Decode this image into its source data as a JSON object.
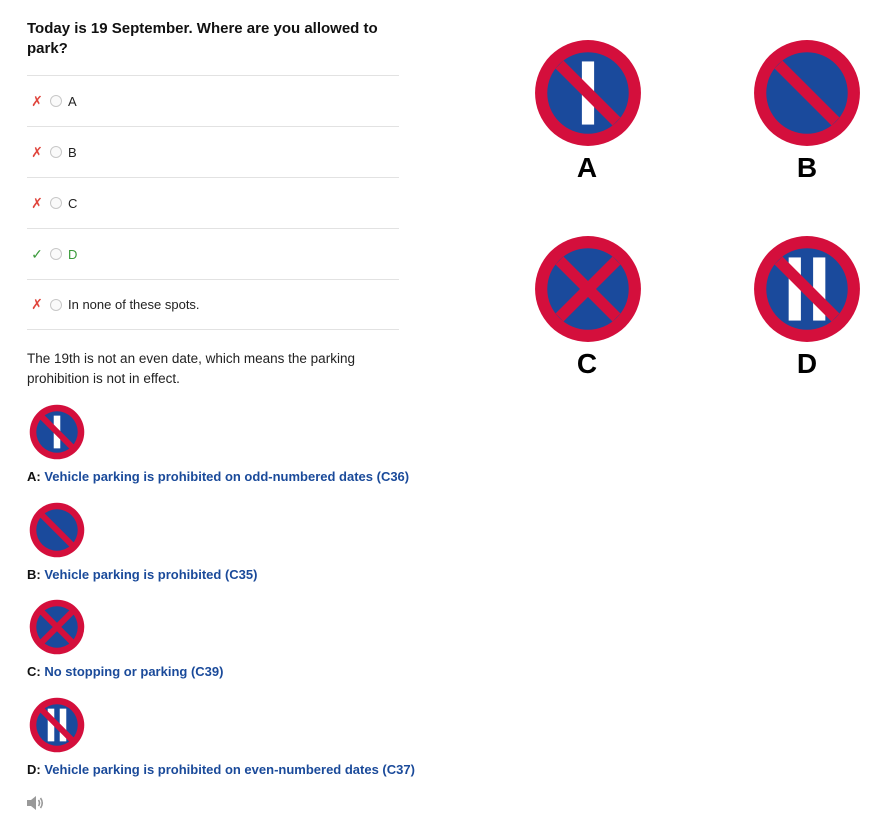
{
  "question": "Today is 19 September. Where are you allowed to park?",
  "options": [
    {
      "label": "A",
      "result": "wrong",
      "mark": "✗"
    },
    {
      "label": "B",
      "result": "wrong",
      "mark": "✗"
    },
    {
      "label": "C",
      "result": "wrong",
      "mark": "✗"
    },
    {
      "label": "D",
      "result": "correct",
      "mark": "✓"
    },
    {
      "label": "In none of these spots.",
      "result": "wrong",
      "mark": "✗"
    }
  ],
  "explanation": "The 19th is not an even date, which means the parking prohibition is not in effect.",
  "references": [
    {
      "letter": "A:",
      "text": "Vehicle parking is prohibited on odd-numbered dates (C36)",
      "sign": "one-bar"
    },
    {
      "letter": "B:",
      "text": "Vehicle parking is prohibited (C35)",
      "sign": "slash"
    },
    {
      "letter": "C:",
      "text": "No stopping or parking (C39)",
      "sign": "cross"
    },
    {
      "letter": "D:",
      "text": "Vehicle parking is prohibited on even-numbered dates (C37)",
      "sign": "two-bars"
    }
  ],
  "signs": [
    {
      "letter": "A",
      "type": "one-bar"
    },
    {
      "letter": "B",
      "type": "slash"
    },
    {
      "letter": "C",
      "type": "cross"
    },
    {
      "letter": "D",
      "type": "two-bars"
    }
  ],
  "colors": {
    "sign_red": "#d40f3c",
    "sign_blue": "#1a4a9c",
    "link": "#1a4a9a",
    "wrong": "#e0453c",
    "right": "#3a9a3a"
  },
  "icons": {
    "speaker": "speaker-icon",
    "wrong": "x-mark-icon",
    "right": "check-mark-icon"
  }
}
